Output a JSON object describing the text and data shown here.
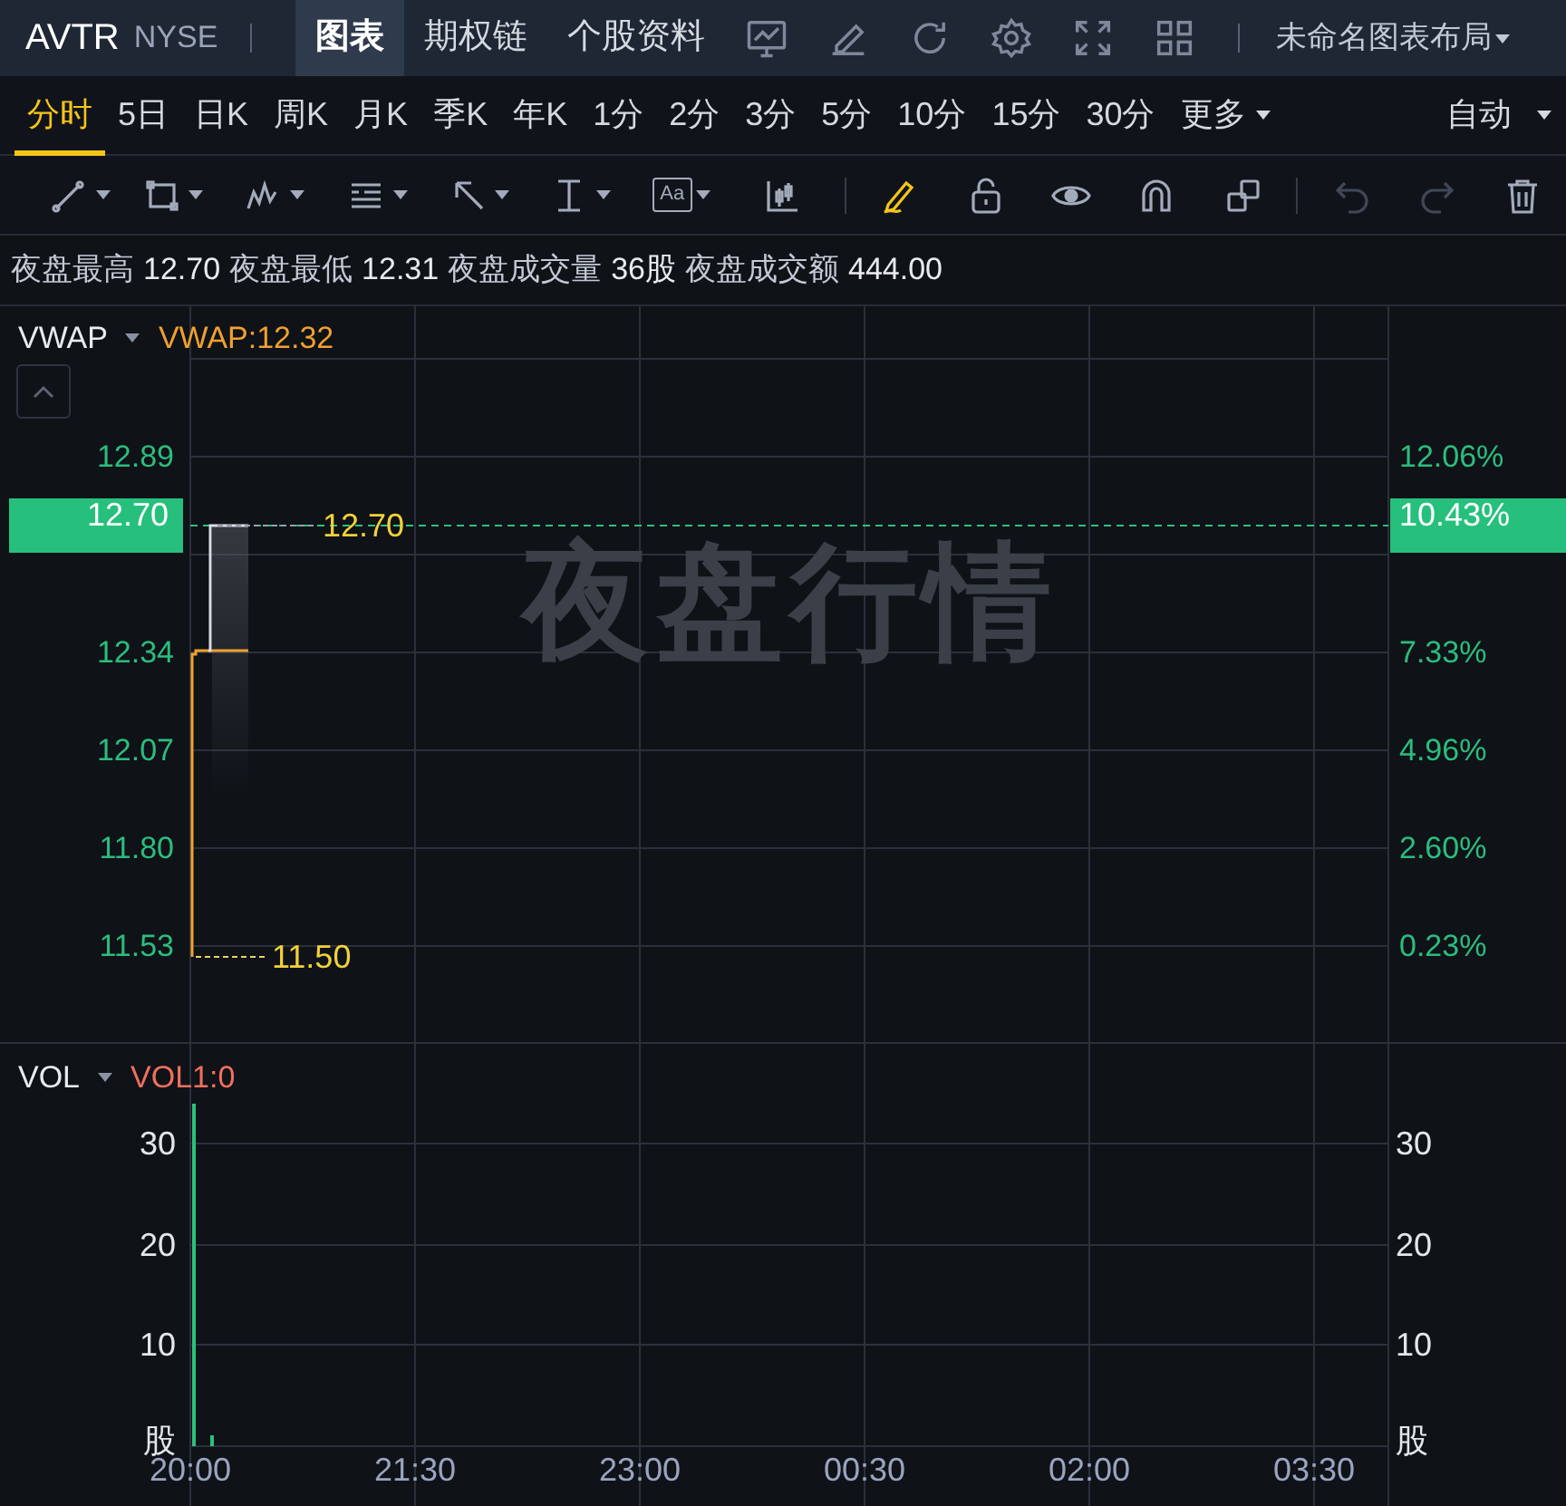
{
  "header": {
    "symbol": "AVTR",
    "exchange": "NYSE",
    "tabs": [
      {
        "label": "图表",
        "selected": true
      },
      {
        "label": "期权链",
        "selected": false
      },
      {
        "label": "个股资料",
        "selected": false
      }
    ],
    "tools": [
      {
        "kind": "chart"
      },
      {
        "kind": "edit"
      },
      {
        "kind": "refresh"
      },
      {
        "kind": "settings"
      },
      {
        "kind": "fullscreen"
      },
      {
        "kind": "layout"
      }
    ],
    "layout_menu": "未命名图表布局"
  },
  "periods": [
    {
      "label": "分时",
      "selected": true,
      "kind": "tab"
    },
    {
      "label": "5日",
      "selected": false,
      "kind": "tab"
    },
    {
      "label": "日K",
      "selected": false,
      "kind": "tab"
    },
    {
      "label": "周K",
      "selected": false,
      "kind": "tab"
    },
    {
      "label": "月K",
      "selected": false,
      "kind": "tab"
    },
    {
      "label": "季K",
      "selected": false,
      "kind": "tab"
    },
    {
      "label": "年K",
      "selected": false,
      "kind": "tab"
    },
    {
      "label": "1分",
      "selected": false,
      "kind": "tab"
    },
    {
      "label": "2分",
      "selected": false,
      "kind": "tab"
    },
    {
      "label": "3分",
      "selected": false,
      "kind": "tab"
    },
    {
      "label": "5分",
      "selected": false,
      "kind": "tab"
    },
    {
      "label": "10分",
      "selected": false,
      "kind": "tab"
    },
    {
      "label": "15分",
      "selected": false,
      "kind": "tab"
    },
    {
      "label": "30分",
      "selected": false,
      "kind": "tab"
    },
    {
      "label": "更多",
      "selected": false,
      "kind": "menu"
    }
  ],
  "scale_mode": "自动",
  "drawing_tools": [
    {
      "kind": "line",
      "selected": false,
      "disabled": false
    },
    {
      "kind": "rect",
      "selected": false,
      "disabled": false
    },
    {
      "kind": "wave",
      "selected": false,
      "disabled": false
    },
    {
      "kind": "fib",
      "selected": false,
      "disabled": false
    },
    {
      "kind": "arrow",
      "selected": false,
      "disabled": false
    },
    {
      "kind": "measure",
      "selected": false,
      "disabled": false
    },
    {
      "kind": "text",
      "label": "Aa",
      "selected": false,
      "disabled": false
    },
    {
      "kind": "candle",
      "selected": false,
      "disabled": false
    },
    {
      "kind": "pencil",
      "selected": true,
      "disabled": false
    },
    {
      "kind": "lock",
      "selected": false,
      "disabled": false
    },
    {
      "kind": "eye",
      "selected": false,
      "disabled": false
    },
    {
      "kind": "magnet",
      "selected": false,
      "disabled": false
    },
    {
      "kind": "clone",
      "selected": false,
      "disabled": false
    },
    {
      "kind": "undo",
      "selected": false,
      "disabled": true
    },
    {
      "kind": "redo",
      "selected": false,
      "disabled": true
    },
    {
      "kind": "trash",
      "selected": false,
      "disabled": false
    }
  ],
  "stats": [
    {
      "label": "夜盘最高",
      "value": "12.70"
    },
    {
      "label": "夜盘最低",
      "value": "12.31"
    },
    {
      "label": "夜盘成交量",
      "value": "36股"
    },
    {
      "label": "夜盘成交额",
      "value": "444.00"
    }
  ],
  "price_panel": {
    "indicator": "VWAP",
    "indicator_value": "VWAP:12.32",
    "watermark": "夜盘行情",
    "price_labels": [
      "12.89",
      "12.34",
      "12.07",
      "11.80",
      "11.53"
    ],
    "percent_labels": [
      "12.06%",
      "7.33%",
      "4.96%",
      "2.60%",
      "0.23%"
    ],
    "last_price_label": "12.70",
    "last_percent_label": "10.43%",
    "high_marker": "12.70",
    "low_marker": "11.50"
  },
  "volume_panel": {
    "indicator": "VOL",
    "indicator_value": "VOL1:0",
    "left_labels": [
      "30",
      "20",
      "10",
      "股"
    ],
    "right_labels": [
      "30",
      "20",
      "10",
      "股"
    ],
    "time_labels": [
      "20:00",
      "21:30",
      "23:00",
      "00:30",
      "02:00",
      "03:30"
    ]
  }
}
